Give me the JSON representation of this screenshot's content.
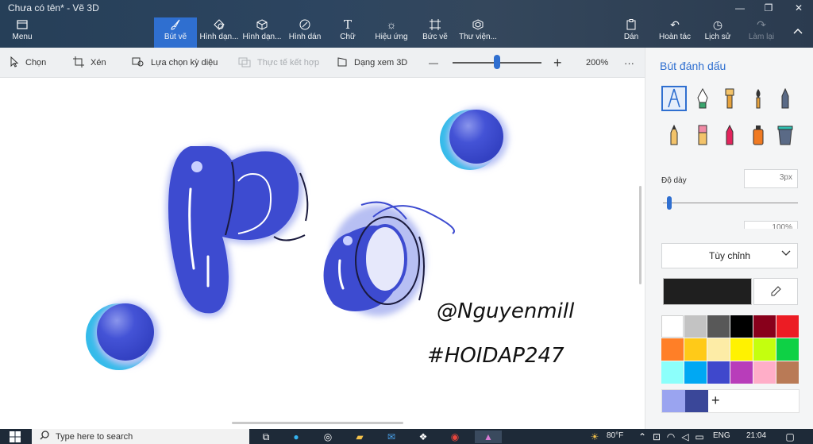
{
  "window": {
    "title": "Chưa có tên* - Vẽ 3D",
    "minimize": "—",
    "maximize": "❐",
    "close": "✕"
  },
  "toolbar": {
    "menu": {
      "label": "Menu",
      "icon": "menu-icon"
    },
    "tools": [
      {
        "label": "Bút vẽ",
        "icon": "brush-icon",
        "active": true
      },
      {
        "label": "Hình dạn...",
        "icon": "2d-shapes-icon"
      },
      {
        "label": "Hình dạn...",
        "icon": "3d-shapes-icon"
      },
      {
        "label": "Hình dán",
        "icon": "sticker-icon"
      },
      {
        "label": "Chữ",
        "icon": "text-icon"
      },
      {
        "label": "Hiệu ứng",
        "icon": "effects-icon"
      },
      {
        "label": "Bức vẽ",
        "icon": "canvas-icon"
      },
      {
        "label": "Thư viện...",
        "icon": "library-icon"
      }
    ],
    "right": [
      {
        "label": "Dán",
        "icon": "paste-icon"
      },
      {
        "label": "Hoàn tác",
        "icon": "undo-icon"
      },
      {
        "label": "Lịch sử",
        "icon": "history-icon"
      },
      {
        "label": "Làm lại",
        "icon": "redo-icon",
        "disabled": true
      }
    ]
  },
  "subbar": {
    "select": "Chọn",
    "crop": "Xén",
    "magic_select": "Lựa chọn kỳ diệu",
    "mixed_reality": "Thực tế kết hợp",
    "view_3d": "Dạng xem 3D",
    "zoom_out": "—",
    "zoom_in": "+",
    "zoom": "200%",
    "zoom_fraction": 0.5,
    "more": "···"
  },
  "canvas": {
    "signature_line1": "@Nguyenmill",
    "signature_line2": "#HOIDAP247"
  },
  "panel": {
    "title": "Bút đánh dấu",
    "thickness_label": "Độ dày",
    "thickness_value": "3px",
    "opacity_value": "100%",
    "thickness_fraction": 0.03,
    "dropdown": "Tùy chỉnh",
    "current_color": "#1f1f1f",
    "palette": [
      "#ffffff",
      "#c3c3c3",
      "#585858",
      "#000000",
      "#88001b",
      "#ec1c24",
      "#ff7f27",
      "#ffca18",
      "#fdeca6",
      "#fff200",
      "#c4ff0e",
      "#0ed145",
      "#8cfffb",
      "#00a8f3",
      "#3f48cc",
      "#b83dba",
      "#ffaec8",
      "#b97a56"
    ],
    "custom_colors": [
      "#9aa4f0",
      "#3a4799"
    ],
    "add": "+"
  },
  "taskbar": {
    "search_placeholder": "Type here to search",
    "weather": "80°F",
    "lang": "ENG",
    "time": "21:04"
  }
}
